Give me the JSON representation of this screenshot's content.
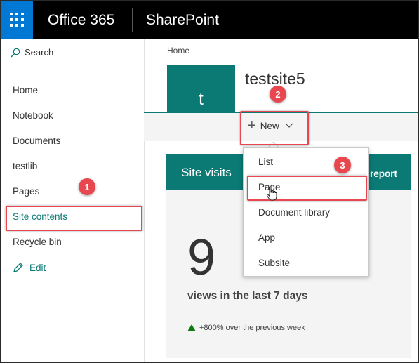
{
  "topbar": {
    "app_name": "Office 365",
    "product_name": "SharePoint",
    "waffle_icon": "app-launcher-icon",
    "brand_color": "#0078d4"
  },
  "leftnav": {
    "search_label": "Search",
    "items": [
      {
        "label": "Home"
      },
      {
        "label": "Notebook"
      },
      {
        "label": "Documents"
      },
      {
        "label": "testlib"
      },
      {
        "label": "Pages"
      },
      {
        "label": "Site contents"
      },
      {
        "label": "Recycle bin"
      }
    ],
    "edit_label": "Edit"
  },
  "main": {
    "breadcrumb": "Home",
    "site_logo_letter": "t",
    "site_title": "testsite5",
    "new_button_label": "New",
    "accent_color": "#0b7a75"
  },
  "card": {
    "title": "Site visits",
    "link_label": "report",
    "count": "9",
    "count_label": "views in the last 7 days",
    "trend_text": "+800% over the previous week"
  },
  "new_menu": {
    "items": [
      {
        "label": "List"
      },
      {
        "label": "Page"
      },
      {
        "label": "Document library"
      },
      {
        "label": "App"
      },
      {
        "label": "Subsite"
      }
    ]
  },
  "annotations": {
    "badges": [
      "1",
      "2",
      "3"
    ],
    "highlight_color": "#e8474f"
  }
}
